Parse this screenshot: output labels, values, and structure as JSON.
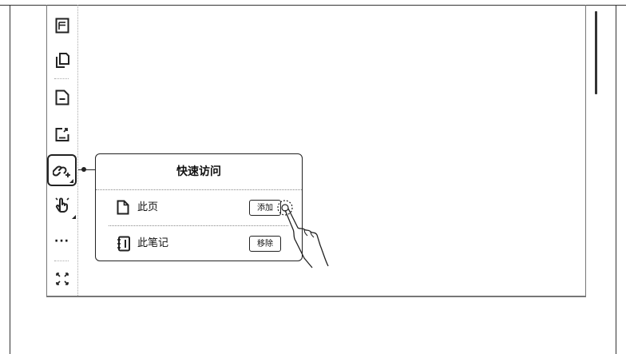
{
  "toolbar": {
    "items": [
      {
        "icon": "page-layout-icon"
      },
      {
        "icon": "copy-pages-icon"
      },
      {
        "icon": "remove-page-icon"
      },
      {
        "icon": "export-icon"
      },
      {
        "icon": "quick-access-link-icon",
        "selected": true
      },
      {
        "icon": "gesture-touch-icon"
      },
      {
        "icon": "more-icon",
        "label": "···"
      },
      {
        "icon": "fullscreen-icon"
      }
    ]
  },
  "quick_access": {
    "title": "快速访问",
    "rows": [
      {
        "icon": "page-icon",
        "label": "此页",
        "button": "添加"
      },
      {
        "icon": "notebook-icon",
        "label": "此笔记",
        "button": "移除"
      }
    ]
  }
}
